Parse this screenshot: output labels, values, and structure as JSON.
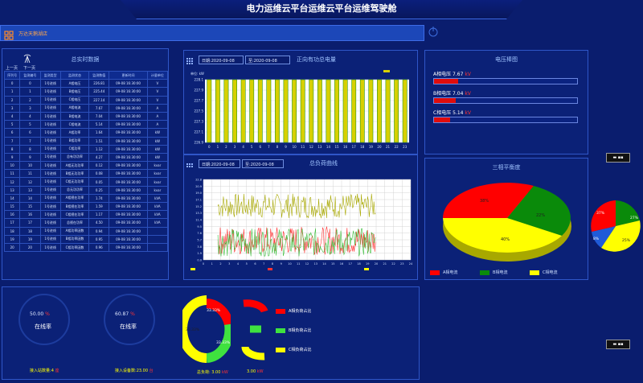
{
  "title": "电力运维云平台运维云平台运维驾驶舱",
  "nav": {
    "company": "万达天鹅湖店"
  },
  "realtime": {
    "title": "总实时数据",
    "prev": "上一页",
    "next": "下一页",
    "headers": [
      "序列号",
      "监测编号",
      "监测类型",
      "监测状态",
      "监测数值",
      "更新时间",
      "计量单位"
    ],
    "rows": [
      [
        "0",
        "0",
        "1号进线",
        "A相电压",
        "226.81",
        "09-08 16:30:00",
        "V"
      ],
      [
        "1",
        "1",
        "1号进线",
        "B相电压",
        "225.44",
        "09-08 16:30:00",
        "V"
      ],
      [
        "2",
        "2",
        "1号进线",
        "C相电压",
        "227.14",
        "09-08 16:30:00",
        "V"
      ],
      [
        "3",
        "3",
        "1号进线",
        "A相电流",
        "7.67",
        "09-08 16:30:00",
        "A"
      ],
      [
        "4",
        "4",
        "1号进线",
        "B相电流",
        "7.04",
        "09-08 16:30:00",
        "A"
      ],
      [
        "5",
        "5",
        "1号进线",
        "C相电流",
        "5.14",
        "09-08 16:30:00",
        "A"
      ],
      [
        "6",
        "6",
        "1号进线",
        "A相功率",
        "1.64",
        "09-08 16:30:00",
        "kW"
      ],
      [
        "7",
        "7",
        "1号进线",
        "B相功率",
        "1.51",
        "09-08 16:30:00",
        "kW"
      ],
      [
        "8",
        "8",
        "1号进线",
        "C相功率",
        "1.12",
        "09-08 16:30:00",
        "kW"
      ],
      [
        "9",
        "9",
        "1号进线",
        "总有功功率",
        "4.27",
        "09-08 16:30:00",
        "kW"
      ],
      [
        "10",
        "10",
        "1号进线",
        "A相无功功率",
        "0.12",
        "09-08 16:30:00",
        "kvar"
      ],
      [
        "11",
        "11",
        "1号进线",
        "B相无功功率",
        "0.08",
        "09-08 16:30:00",
        "kvar"
      ],
      [
        "12",
        "12",
        "1号进线",
        "C相无功功率",
        "0.05",
        "09-08 16:30:00",
        "kvar"
      ],
      [
        "13",
        "13",
        "1号进线",
        "总无功功率",
        "0.25",
        "09-08 16:30:00",
        "kvar"
      ],
      [
        "14",
        "14",
        "1号进线",
        "A相视在功率",
        "1.74",
        "09-08 16:30:00",
        "kVA"
      ],
      [
        "15",
        "15",
        "1号进线",
        "B相视在功率",
        "1.59",
        "09-08 16:30:00",
        "kVA"
      ],
      [
        "16",
        "16",
        "1号进线",
        "C相视在功率",
        "1.17",
        "09-08 16:30:00",
        "kVA"
      ],
      [
        "17",
        "17",
        "1号进线",
        "总视在功率",
        "4.50",
        "09-08 16:30:00",
        "kVA"
      ],
      [
        "18",
        "18",
        "1号进线",
        "A相功率因数",
        "0.94",
        "09-08 16:30:00",
        ""
      ],
      [
        "19",
        "19",
        "1号进线",
        "B相功率因数",
        "0.95",
        "09-08 16:30:00",
        ""
      ],
      [
        "20",
        "20",
        "1号进线",
        "C相功率因数",
        "0.96",
        "09-08 16:30:00",
        ""
      ]
    ]
  },
  "energy": {
    "title": "正向有功总电量",
    "date_label": "日期:",
    "date": "2020-09-08",
    "to_label": "至:",
    "to": "2020-09-08"
  },
  "load": {
    "title": "总负荷曲线",
    "date_label": "日期:",
    "date": "2020-09-08",
    "to_label": "至:",
    "to": "2020-09-08"
  },
  "voltage": {
    "title": "电压棒图",
    "items": [
      {
        "label": "A相电压",
        "value": "7.67",
        "unit": "kV",
        "fill": 0.17
      },
      {
        "label": "B相电压",
        "value": "7.04",
        "unit": "kV",
        "fill": 0.15
      },
      {
        "label": "C相电压",
        "value": "5.14",
        "unit": "kV",
        "fill": 0.11
      }
    ]
  },
  "balance": {
    "title": "三相平衡度",
    "legend": [
      "A相电流",
      "B相电流",
      "C相电流"
    ],
    "pct": {
      "a": "38%",
      "b": "22%",
      "c": "40%"
    }
  },
  "online": [
    {
      "value": "50.00",
      "unit": "%",
      "label": "在线率",
      "foot_label": "接入站数量:",
      "foot_value": "4",
      "foot_unit": "座"
    },
    {
      "value": "60.87",
      "unit": "%",
      "label": "在线率",
      "foot_label": "接入设备数:",
      "foot_value": "23.00",
      "foot_unit": "台"
    }
  ],
  "load_ratio": {
    "donut_pct": {
      "r": "33.33%",
      "g": "33.33%",
      "y": "33.33%"
    },
    "legend": [
      "A相负荷占比",
      "B相负荷占比",
      "C相负荷占比"
    ],
    "total_label": "总负荷:",
    "total_value": "3.00",
    "total_unit": "kW"
  },
  "mini_pct": {
    "r": "37%",
    "g": "27%",
    "b": "8%",
    "y": "25%"
  },
  "colors": {
    "red": "#ff0000",
    "green": "#0a8a0a",
    "yellow": "#ffff00",
    "bar": "#d7d000",
    "blue": "#1f5bd8"
  },
  "chart_data": [
    {
      "type": "bar",
      "title": "正向有功总电量",
      "categories": [
        "0",
        "1",
        "2",
        "3",
        "4",
        "5",
        "6",
        "7",
        "8",
        "9",
        "10",
        "11",
        "12",
        "13",
        "14",
        "15",
        "16",
        "17",
        "18",
        "19",
        "20",
        "21",
        "22",
        "23"
      ],
      "series": [
        {
          "name": "正向有功总电量",
          "values": [
            226.4,
            226.4,
            226.4,
            226.4,
            226.4,
            226.4,
            226.4,
            226.4,
            226.4,
            226.4,
            226.4,
            226.4,
            226.4,
            226.4,
            226.4,
            226.4,
            226.4,
            226.4,
            226.4,
            226.4,
            226.4,
            226.4,
            226.4,
            226.4
          ]
        }
      ],
      "ylim": [
        226.9,
        228.1
      ],
      "ylabel": "单位: kW"
    },
    {
      "type": "line",
      "title": "总负荷曲线",
      "series": [
        {
          "name": "A相",
          "base": 15.3
        },
        {
          "name": "B相",
          "base": 5.5
        },
        {
          "name": "C相",
          "base": 5.0
        }
      ],
      "ylim": [
        0,
        22.8
      ],
      "xrange": [
        0,
        24
      ]
    },
    {
      "type": "pie",
      "title": "三相平衡度",
      "labels": [
        "A相电流",
        "B相电流",
        "C相电流"
      ],
      "values": [
        38,
        22,
        40
      ]
    }
  ]
}
